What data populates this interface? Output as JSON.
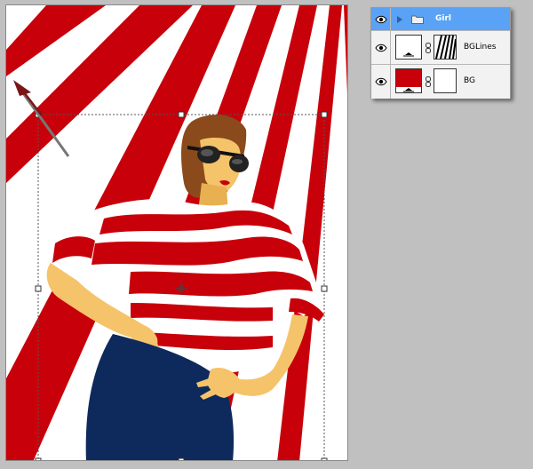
{
  "layers": [
    {
      "name": "Girl",
      "type": "group",
      "selected": true,
      "visible": true
    },
    {
      "name": "BGLines",
      "type": "layer",
      "selected": false,
      "visible": true
    },
    {
      "name": "BG",
      "type": "layer",
      "selected": false,
      "visible": true
    }
  ],
  "colors": {
    "stripe_red": "#c8000a",
    "panel_selected": "#5aa2f5",
    "workspace": "#c0c0c0"
  },
  "icons": [
    "eye-icon",
    "folder-icon",
    "disclosure-triangle-icon",
    "chain-link-icon",
    "move-arrow-icon"
  ]
}
